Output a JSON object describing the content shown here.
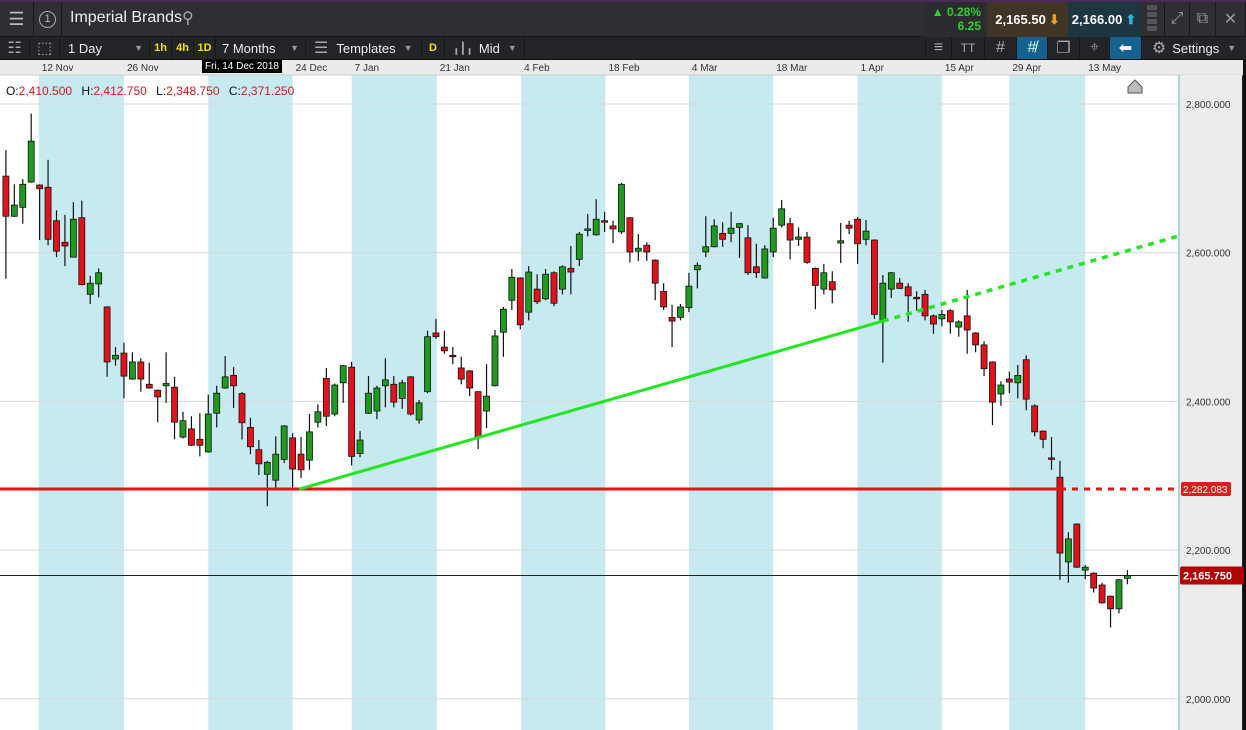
{
  "header": {
    "title": "Imperial Brands",
    "change_pct": "0.28%",
    "change_abs": "6.25",
    "sell": "2,165.50",
    "buy": "2,166.00",
    "panel_number": "1"
  },
  "toolbar": {
    "interval": "1 Day",
    "quick": [
      "1h",
      "4h",
      "1D"
    ],
    "range": "7 Months",
    "templates": "Templates",
    "d_button": "D",
    "price_type": "Mid",
    "settings": "Settings",
    "text_size": "TT"
  },
  "ohlc": {
    "o_label": "O:",
    "o": "2,410.500",
    "h_label": "H:",
    "h": "2,412.750",
    "l_label": "L:",
    "l": "2,348.750",
    "c_label": "C:",
    "c": "2,371.250"
  },
  "crosshair_date": "Fri, 14 Dec 2018",
  "chart_data": {
    "type": "candlestick",
    "title": "Imperial Brands",
    "ylim": [
      1958,
      2839
    ],
    "xlim": [
      0.3,
      140
    ],
    "y_ticks": [
      2800,
      2600,
      2400,
      2200,
      2000
    ],
    "y_tick_labels": [
      "2,800.000",
      "2,600.000",
      "2,400.000",
      "2,200.000",
      "2,000.000"
    ],
    "x_labels": [
      {
        "label": "12 Nov",
        "index": 4.9
      },
      {
        "label": "26 Nov",
        "index": 15
      },
      {
        "label": "24 Dec",
        "index": 35
      },
      {
        "label": "7 Jan",
        "index": 42
      },
      {
        "label": "21 Jan",
        "index": 52.1
      },
      {
        "label": "4 Feb",
        "index": 62.1
      },
      {
        "label": "18 Feb",
        "index": 72.1
      },
      {
        "label": "4 Mar",
        "index": 82
      },
      {
        "label": "18 Mar",
        "index": 92
      },
      {
        "label": "1 Apr",
        "index": 102
      },
      {
        "label": "15 Apr",
        "index": 112
      },
      {
        "label": "29 Apr",
        "index": 120
      },
      {
        "label": "13 May",
        "index": 129
      }
    ],
    "shaded_ranges": [
      [
        4.9,
        15
      ],
      [
        25,
        35
      ],
      [
        42,
        52.1
      ],
      [
        62.1,
        72.1
      ],
      [
        82,
        92
      ],
      [
        102,
        112
      ],
      [
        120,
        129
      ]
    ],
    "selected_index": 29,
    "candles_ohlc": [
      [
        2703,
        2738,
        2565,
        2649
      ],
      [
        2649,
        2692,
        2648,
        2664
      ],
      [
        2661,
        2699,
        2639,
        2692
      ],
      [
        2695,
        2787,
        2694,
        2750
      ],
      [
        2691,
        2692,
        2617,
        2686
      ],
      [
        2688,
        2725,
        2610,
        2618
      ],
      [
        2643,
        2657,
        2594,
        2602
      ],
      [
        2614,
        2651,
        2582,
        2609
      ],
      [
        2594,
        2668,
        2594,
        2645
      ],
      [
        2647,
        2670,
        2556,
        2557
      ],
      [
        2544,
        2569,
        2531,
        2559
      ],
      [
        2558,
        2579,
        2540,
        2573
      ],
      [
        2527,
        2528,
        2433,
        2453
      ],
      [
        2457,
        2473,
        2448,
        2462
      ],
      [
        2465,
        2479,
        2404,
        2434
      ],
      [
        2430,
        2466,
        2429,
        2453
      ],
      [
        2453,
        2458,
        2413,
        2430
      ],
      [
        2423,
        2452,
        2417,
        2418
      ],
      [
        2415,
        2416,
        2372,
        2406
      ],
      [
        2421,
        2466,
        2398,
        2424
      ],
      [
        2419,
        2433,
        2349,
        2372
      ],
      [
        2352,
        2386,
        2350,
        2374
      ],
      [
        2363,
        2380,
        2340,
        2341
      ],
      [
        2349,
        2384,
        2326,
        2341
      ],
      [
        2332,
        2409,
        2331,
        2383
      ],
      [
        2384,
        2421,
        2365,
        2411
      ],
      [
        2418,
        2461,
        2417,
        2433
      ],
      [
        2435,
        2446,
        2391,
        2421
      ],
      [
        2410.5,
        2412.75,
        2348.75,
        2371.25
      ],
      [
        2365,
        2378,
        2329,
        2339
      ],
      [
        2335,
        2348,
        2301,
        2316
      ],
      [
        2302,
        2320,
        2259,
        2318
      ],
      [
        2294,
        2353,
        2283,
        2329
      ],
      [
        2322,
        2368,
        2317,
        2367
      ],
      [
        2351,
        2357,
        2283,
        2309
      ],
      [
        2329,
        2352,
        2297,
        2308
      ],
      [
        2321,
        2383,
        2308,
        2359
      ],
      [
        2372,
        2396,
        2365,
        2386
      ],
      [
        2431,
        2445,
        2367,
        2380
      ],
      [
        2383,
        2424,
        2380,
        2422
      ],
      [
        2425,
        2449,
        2398,
        2448
      ],
      [
        2446,
        2453,
        2314,
        2326
      ],
      [
        2330,
        2360,
        2325,
        2348
      ],
      [
        2384,
        2434,
        2383,
        2411
      ],
      [
        2387,
        2421,
        2376,
        2418
      ],
      [
        2421,
        2458,
        2392,
        2429
      ],
      [
        2423,
        2434,
        2392,
        2399
      ],
      [
        2404,
        2429,
        2390,
        2425
      ],
      [
        2433,
        2434,
        2381,
        2383
      ],
      [
        2375,
        2402,
        2370,
        2398
      ],
      [
        2413,
        2495,
        2411,
        2487
      ],
      [
        2492,
        2511,
        2484,
        2487
      ],
      [
        2473,
        2495,
        2464,
        2468
      ],
      [
        2462,
        2473,
        2450,
        2461
      ],
      [
        2445,
        2460,
        2423,
        2430
      ],
      [
        2441,
        2442,
        2407,
        2418
      ],
      [
        2413,
        2414,
        2336,
        2352
      ],
      [
        2387,
        2450,
        2364,
        2407
      ],
      [
        2421,
        2496,
        2420,
        2488
      ],
      [
        2493,
        2527,
        2460,
        2524
      ],
      [
        2536,
        2578,
        2523,
        2567
      ],
      [
        2566,
        2567,
        2497,
        2503
      ],
      [
        2520,
        2582,
        2509,
        2574
      ],
      [
        2551,
        2571,
        2531,
        2534
      ],
      [
        2538,
        2578,
        2536,
        2571
      ],
      [
        2573,
        2575,
        2528,
        2532
      ],
      [
        2551,
        2583,
        2544,
        2581
      ],
      [
        2579,
        2609,
        2544,
        2574
      ],
      [
        2591,
        2628,
        2582,
        2625
      ],
      [
        2632,
        2652,
        2622,
        2632
      ],
      [
        2624,
        2672,
        2623,
        2645
      ],
      [
        2643,
        2655,
        2628,
        2642
      ],
      [
        2636,
        2643,
        2613,
        2632
      ],
      [
        2628,
        2694,
        2625,
        2692
      ],
      [
        2647,
        2648,
        2587,
        2601
      ],
      [
        2602,
        2625,
        2589,
        2606
      ],
      [
        2610,
        2614,
        2589,
        2601
      ],
      [
        2590,
        2591,
        2536,
        2559
      ],
      [
        2548,
        2559,
        2523,
        2527
      ],
      [
        2513,
        2530,
        2473,
        2508
      ],
      [
        2513,
        2531,
        2509,
        2527
      ],
      [
        2526,
        2573,
        2520,
        2555
      ],
      [
        2577,
        2587,
        2552,
        2583
      ],
      [
        2601,
        2649,
        2594,
        2608
      ],
      [
        2608,
        2645,
        2607,
        2636
      ],
      [
        2626,
        2641,
        2608,
        2618
      ],
      [
        2626,
        2655,
        2614,
        2633
      ],
      [
        2634,
        2640,
        2593,
        2639
      ],
      [
        2620,
        2637,
        2570,
        2573
      ],
      [
        2581,
        2612,
        2566,
        2573
      ],
      [
        2566,
        2610,
        2565,
        2605
      ],
      [
        2601,
        2647,
        2594,
        2633
      ],
      [
        2637,
        2671,
        2634,
        2659
      ],
      [
        2639,
        2647,
        2591,
        2617
      ],
      [
        2618,
        2634,
        2609,
        2621
      ],
      [
        2621,
        2628,
        2585,
        2587
      ],
      [
        2579,
        2580,
        2524,
        2556
      ],
      [
        2551,
        2585,
        2544,
        2573
      ],
      [
        2561,
        2575,
        2532,
        2550
      ],
      [
        2613,
        2640,
        2586,
        2616
      ],
      [
        2637,
        2643,
        2625,
        2633
      ],
      [
        2645,
        2648,
        2585,
        2612
      ],
      [
        2618,
        2644,
        2610,
        2629
      ],
      [
        2617,
        2618,
        2511,
        2517
      ],
      [
        2508,
        2570,
        2452,
        2559
      ],
      [
        2551,
        2574,
        2539,
        2573
      ],
      [
        2559,
        2566,
        2551,
        2552
      ],
      [
        2554,
        2559,
        2507,
        2542
      ],
      [
        2540,
        2548,
        2522,
        2539
      ],
      [
        2544,
        2550,
        2509,
        2515
      ],
      [
        2515,
        2517,
        2491,
        2504
      ],
      [
        2511,
        2523,
        2501,
        2517
      ],
      [
        2522,
        2524,
        2491,
        2507
      ],
      [
        2500,
        2509,
        2487,
        2507
      ],
      [
        2515,
        2550,
        2464,
        2496
      ],
      [
        2492,
        2493,
        2466,
        2476
      ],
      [
        2476,
        2481,
        2434,
        2444
      ],
      [
        2453,
        2454,
        2368,
        2399
      ],
      [
        2410,
        2427,
        2394,
        2422
      ],
      [
        2430,
        2440,
        2411,
        2426
      ],
      [
        2425,
        2449,
        2404,
        2435
      ],
      [
        2456,
        2462,
        2388,
        2403
      ],
      [
        2394,
        2396,
        2353,
        2359
      ],
      [
        2360,
        2361,
        2337,
        2349
      ],
      [
        2324,
        2352,
        2308,
        2323
      ],
      [
        2298,
        2320,
        2160,
        2196
      ],
      [
        2184,
        2224,
        2156,
        2215
      ],
      [
        2235,
        2236,
        2176,
        2177
      ],
      [
        2173,
        2180,
        2161,
        2177
      ],
      [
        2169,
        2170,
        2143,
        2149
      ],
      [
        2153,
        2156,
        2128,
        2129
      ],
      [
        2138,
        2139,
        2096,
        2121
      ],
      [
        2121,
        2161,
        2115,
        2160
      ],
      [
        2162,
        2173,
        2154,
        2165.75
      ]
    ],
    "horizontal_line": {
      "price": 2282.083,
      "label": "2,282.083",
      "solid_until_index": 126,
      "color": "#e01515"
    },
    "trendline": {
      "start": {
        "index": 35.8,
        "price": 2282.083
      },
      "end": {
        "index": 105,
        "price": 2508
      },
      "extended": true,
      "color": "#22e622"
    },
    "current_price": {
      "value": 2165.75,
      "label": "2,165.750",
      "color": "#b00000"
    },
    "colors": {
      "up": "#1e9b1e",
      "down": "#e2121b",
      "band": "#c6eaf0",
      "grid": "#d8d8d8"
    }
  }
}
